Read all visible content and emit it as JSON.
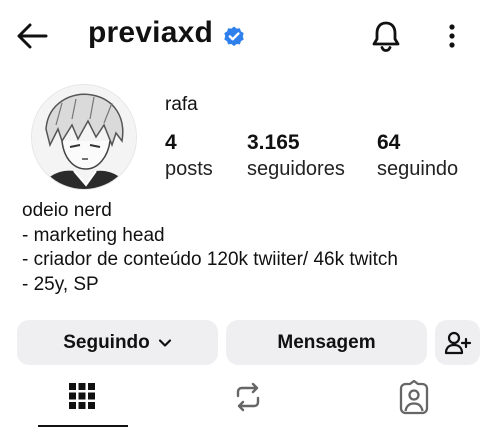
{
  "header": {
    "username": "previaxd",
    "verified": true,
    "accent_color": "#2f80ed",
    "icons": [
      "back-arrow-icon",
      "verified-badge-icon",
      "bell-icon",
      "more-vertical-icon"
    ]
  },
  "profile": {
    "display_name": "rafa",
    "stats": [
      {
        "value": "4",
        "label": "posts"
      },
      {
        "value": "3.165",
        "label": "seguidores"
      },
      {
        "value": "64",
        "label": "seguindo"
      }
    ],
    "bio": [
      "odeio nerd",
      "- marketing head",
      "- criador de conteúdo 120k twiiter/ 46k twitch",
      "- 25y, SP"
    ]
  },
  "actions": {
    "following_label": "Seguindo",
    "message_label": "Mensagem"
  },
  "tabs": [
    {
      "icon": "grid-icon",
      "selected": true
    },
    {
      "icon": "repost-icon",
      "selected": false
    },
    {
      "icon": "tagged-person-icon",
      "selected": false
    }
  ]
}
